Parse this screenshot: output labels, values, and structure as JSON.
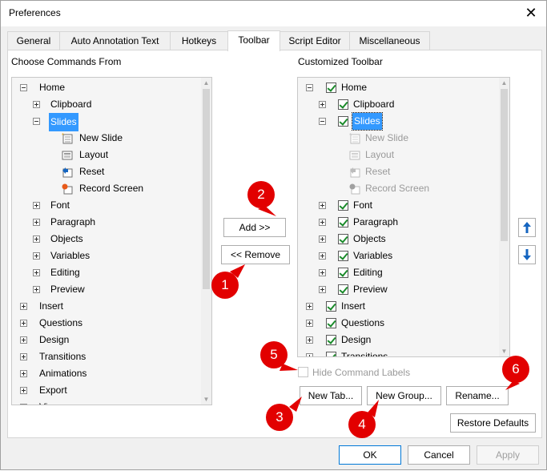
{
  "window": {
    "title": "Preferences"
  },
  "tabs": [
    "General",
    "Auto Annotation Text",
    "Hotkeys",
    "Toolbar",
    "Script Editor",
    "Miscellaneous"
  ],
  "left": {
    "heading": "Choose Commands From",
    "items": {
      "home": "Home",
      "clipboard": "Clipboard",
      "slides": "Slides",
      "new_slide": "New Slide",
      "layout": "Layout",
      "reset": "Reset",
      "record_screen": "Record Screen",
      "font": "Font",
      "paragraph": "Paragraph",
      "objects": "Objects",
      "variables": "Variables",
      "editing": "Editing",
      "preview": "Preview",
      "insert": "Insert",
      "questions": "Questions",
      "design": "Design",
      "transitions": "Transitions",
      "animations": "Animations",
      "export": "Export",
      "view": "View"
    }
  },
  "right": {
    "heading": "Customized Toolbar",
    "items": {
      "home": "Home",
      "clipboard": "Clipboard",
      "slides": "Slides",
      "new_slide": "New Slide",
      "layout": "Layout",
      "reset": "Reset",
      "record_screen": "Record Screen",
      "font": "Font",
      "paragraph": "Paragraph",
      "objects": "Objects",
      "variables": "Variables",
      "editing": "Editing",
      "preview": "Preview",
      "insert": "Insert",
      "questions": "Questions",
      "design": "Design",
      "transitions": "Transitions"
    }
  },
  "buttons": {
    "add": "Add >>",
    "remove": "<< Remove",
    "new_tab": "New Tab...",
    "new_group": "New Group...",
    "rename": "Rename...",
    "restore_defaults": "Restore Defaults",
    "ok": "OK",
    "cancel": "Cancel",
    "apply": "Apply"
  },
  "hide_command_labels": "Hide Command Labels",
  "badges": [
    "1",
    "2",
    "3",
    "4",
    "5",
    "6"
  ],
  "colors": {
    "accent": "#3399ff",
    "badge": "#e20000",
    "check": "#1a8a2a",
    "arrow": "#1565c0"
  }
}
